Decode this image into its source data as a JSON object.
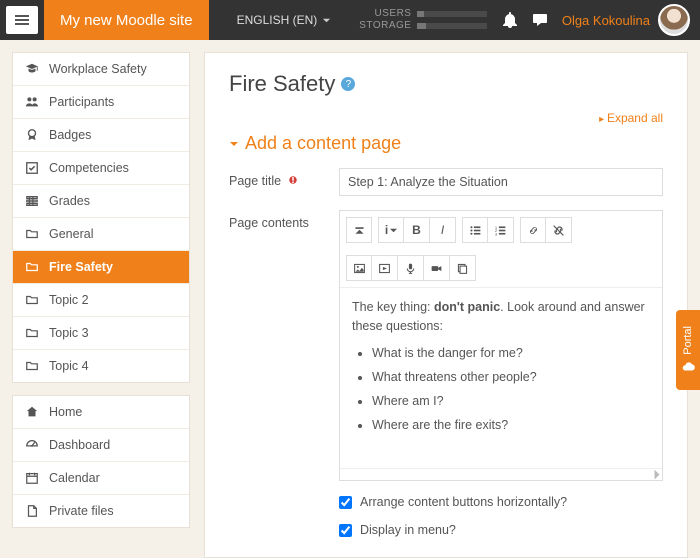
{
  "header": {
    "brand": "My new Moodle site",
    "language": "ENGLISH (EN)",
    "stats": {
      "users_label": "USERS",
      "storage_label": "STORAGE",
      "users_pct": 10,
      "storage_pct": 12
    },
    "user_name": "Olga Kokoulina"
  },
  "sidebar": {
    "course_nav": [
      {
        "icon": "grad-cap",
        "label": "Workplace Safety"
      },
      {
        "icon": "users",
        "label": "Participants"
      },
      {
        "icon": "badge",
        "label": "Badges"
      },
      {
        "icon": "check",
        "label": "Competencies"
      },
      {
        "icon": "grid",
        "label": "Grades"
      },
      {
        "icon": "folder",
        "label": "General"
      },
      {
        "icon": "folder",
        "label": "Fire Safety",
        "active": true
      },
      {
        "icon": "folder",
        "label": "Topic 2"
      },
      {
        "icon": "folder",
        "label": "Topic 3"
      },
      {
        "icon": "folder",
        "label": "Topic 4"
      }
    ],
    "site_nav": [
      {
        "icon": "home",
        "label": "Home"
      },
      {
        "icon": "dashboard",
        "label": "Dashboard"
      },
      {
        "icon": "calendar",
        "label": "Calendar"
      },
      {
        "icon": "file",
        "label": "Private files"
      }
    ]
  },
  "main": {
    "title": "Fire Safety",
    "expand_label": "Expand all",
    "section_heading": "Add a content page",
    "page_title_label": "Page title",
    "page_title_value": "Step 1: Analyze the Situation",
    "page_contents_label": "Page contents",
    "editor_text": {
      "lead_prefix": "The key thing: ",
      "lead_bold": "don't panic",
      "lead_suffix": ". Look around and answer these questions:",
      "bullets": [
        "What is the danger for me?",
        "What threatens other people?",
        "Where am I?",
        "Where are the fire exits?"
      ]
    },
    "arrange_label": "Arrange content buttons horizontally?",
    "arrange_checked": true,
    "display_label": "Display in menu?",
    "display_checked": true
  },
  "portal_label": "Portal"
}
